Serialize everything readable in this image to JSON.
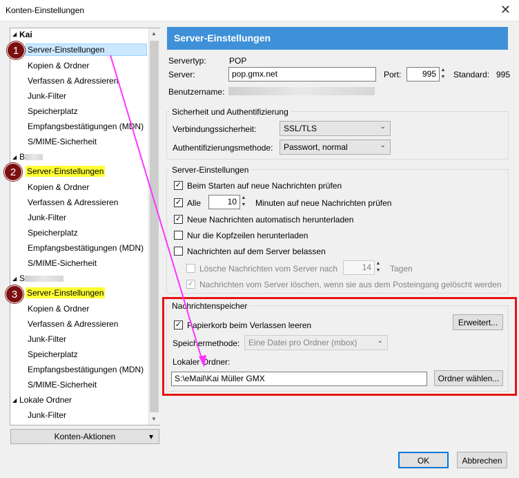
{
  "window": {
    "title": "Konten-Einstellungen",
    "close_glyph": "✕"
  },
  "tree": {
    "account1": "Kai",
    "account2": "B",
    "account3": "S",
    "local": "Lokale Ordner",
    "items": [
      "Server-Einstellungen",
      "Kopien & Ordner",
      "Verfassen & Adressieren",
      "Junk-Filter",
      "Speicherplatz",
      "Empfangsbestätigungen (MDN)",
      "S/MIME-Sicherheit"
    ],
    "local_junk": "Junk-Filter",
    "collapse_glyph": "◢",
    "up_glyph": "▲",
    "down_glyph": "▼"
  },
  "badges": [
    "1",
    "2",
    "3"
  ],
  "account_actions": {
    "label": "Konten-Aktionen",
    "chevron": "▾"
  },
  "panel": {
    "header": "Server-Einstellungen",
    "servertype_label": "Servertyp:",
    "servertype_value": "POP",
    "server_label": "Server:",
    "server_value": "pop.gmx.net",
    "port_label": "Port:",
    "port_value": "995",
    "standard_label": "Standard:",
    "standard_value": "995",
    "username_label": "Benutzername:"
  },
  "security": {
    "title": "Sicherheit und Authentifizierung",
    "conn_label": "Verbindungssicherheit:",
    "conn_value": "SSL/TLS",
    "auth_label": "Authentifizierungsmethode:",
    "auth_value": "Passwort, normal"
  },
  "server_settings": {
    "title": "Server-Einstellungen",
    "check_on_start": "Beim Starten auf neue Nachrichten prüfen",
    "every_label": "Alle",
    "every_value": "10",
    "minutes_label": "Minuten auf neue Nachrichten prüfen",
    "auto_download": "Neue Nachrichten automatisch herunterladen",
    "headers_only": "Nur die Kopfzeilen herunterladen",
    "leave_on_server": "Nachrichten auf dem Server belassen",
    "delete_after": "Lösche Nachrichten vom Server nach",
    "delete_days": "14",
    "days_label": "Tagen",
    "delete_when_deleted": "Nachrichten vom Server löschen, wenn sie aus dem Posteingang gelöscht werden"
  },
  "storage": {
    "title": "Nachrichtenspeicher",
    "empty_trash": "Papierkorb beim Verlassen leeren",
    "advanced_button": "Erweitert...",
    "method_label": "Speichermethode:",
    "method_value": "Eine Datei pro Ordner (mbox)",
    "local_folder_label": "Lokaler Ordner:",
    "local_folder_value": "S:\\eMail\\Kai Müller GMX",
    "choose_folder_button": "Ordner wählen..."
  },
  "footer": {
    "ok": "OK",
    "cancel": "Abbrechen"
  },
  "colors": {
    "header_blue": "#3e90d8",
    "highlight_yellow": "#ffff33",
    "annotation_red": "#e81212",
    "arrow_magenta": "#ff33ff",
    "badge": "#7b0f0f"
  },
  "icons": {
    "check": "✓",
    "chevron": "⌄"
  }
}
